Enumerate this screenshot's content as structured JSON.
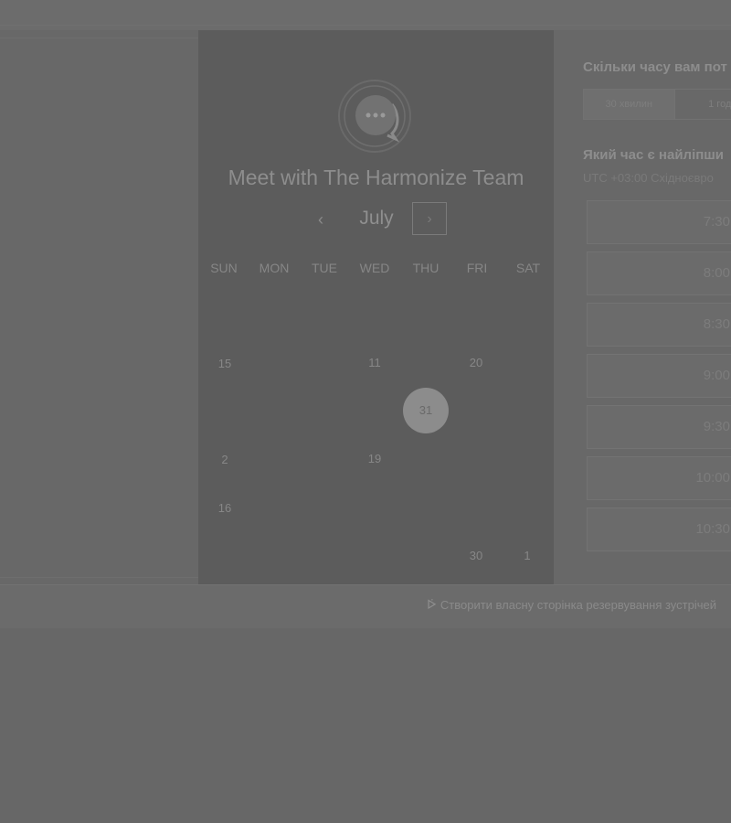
{
  "calendar": {
    "title": "Meet with The Harmonize Team",
    "month": "July",
    "prev_icon": "chevron-left-icon",
    "next_icon": "chevron-right-icon",
    "weekdays": [
      "SUN",
      "MON",
      "TUE",
      "WED",
      "THU",
      "FRI",
      "SAT"
    ],
    "days": [
      "15",
      "11",
      "20",
      "31",
      "2",
      "19",
      "16",
      "30",
      "1"
    ],
    "selected_day": "31"
  },
  "booking": {
    "duration_label": "Скільки часу вам пот",
    "durations": [
      "30 хвилин",
      "1 год"
    ],
    "time_label": "Який час є найліпши",
    "timezone": "UTC +03:00 Східноєвро",
    "slots": [
      "7:30",
      "8:00",
      "8:30",
      "9:00",
      "9:30",
      "10:00",
      "10:30"
    ]
  },
  "footer": {
    "link_icon": "sprocket-icon",
    "link_text": "Створити власну сторінка резервування зустрічей"
  },
  "colors": {
    "overlay": "#666666",
    "card": "#5c5c5c",
    "selected_day": "#8c8c8c"
  }
}
